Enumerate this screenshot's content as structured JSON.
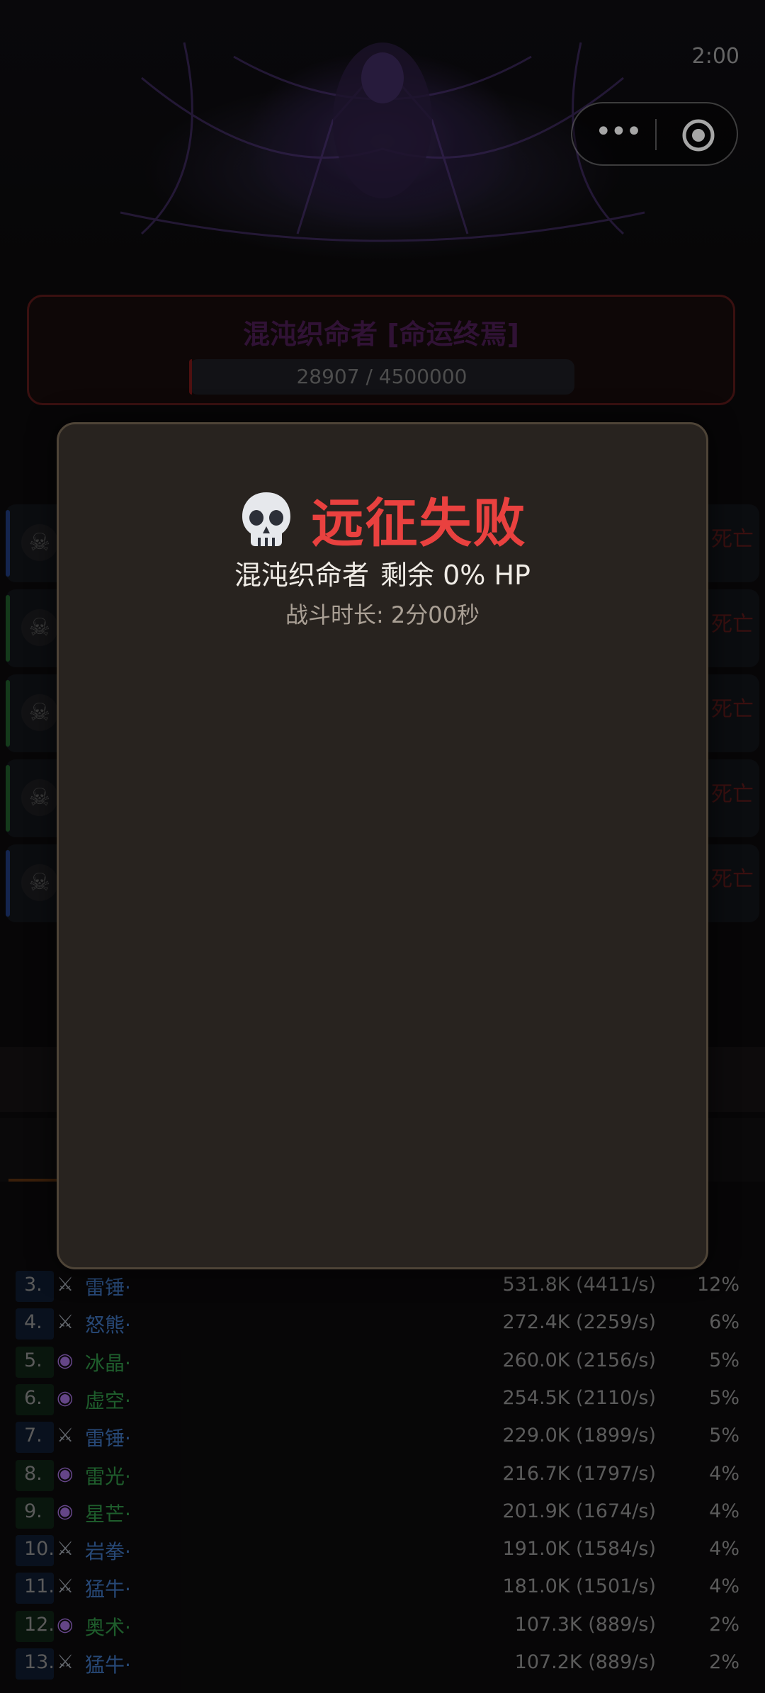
{
  "status_time": "2:00",
  "capsule": {
    "more_icon": "more-dots-icon",
    "close_icon": "target-circle-icon"
  },
  "boss": {
    "name": "混沌织命者 [命运终焉]",
    "hp_text": "28907 / 4500000",
    "hp_fraction": 0.0064
  },
  "party_dead_label": "死亡",
  "party_bar_colors": [
    "#1f3a7a",
    "#1f5a2a",
    "#1f5a2a",
    "#1f5a2a",
    "#1f3a7a"
  ],
  "ranking": [
    {
      "rank": "3.",
      "cls": "warrior",
      "name": "雷锤·",
      "dmg": "531.8K (4411/s)",
      "pct": "12%"
    },
    {
      "rank": "4.",
      "cls": "warrior",
      "name": "怒熊·",
      "dmg": "272.4K (2259/s)",
      "pct": "6%"
    },
    {
      "rank": "5.",
      "cls": "mage",
      "name": "冰晶·",
      "dmg": "260.0K (2156/s)",
      "pct": "5%"
    },
    {
      "rank": "6.",
      "cls": "mage",
      "name": "虚空·",
      "dmg": "254.5K (2110/s)",
      "pct": "5%"
    },
    {
      "rank": "7.",
      "cls": "warrior",
      "name": "雷锤·",
      "dmg": "229.0K (1899/s)",
      "pct": "5%"
    },
    {
      "rank": "8.",
      "cls": "mage",
      "name": "雷光·",
      "dmg": "216.7K (1797/s)",
      "pct": "4%"
    },
    {
      "rank": "9.",
      "cls": "mage",
      "name": "星芒·",
      "dmg": "201.9K (1674/s)",
      "pct": "4%"
    },
    {
      "rank": "10.",
      "cls": "warrior",
      "name": "岩拳·",
      "dmg": "191.0K (1584/s)",
      "pct": "4%"
    },
    {
      "rank": "11.",
      "cls": "warrior",
      "name": "猛牛·",
      "dmg": "181.0K (1501/s)",
      "pct": "4%"
    },
    {
      "rank": "12.",
      "cls": "mage",
      "name": "奥术·",
      "dmg": "107.3K (889/s)",
      "pct": "2%"
    },
    {
      "rank": "13.",
      "cls": "warrior",
      "name": "猛牛·",
      "dmg": "107.2K (889/s)",
      "pct": "2%"
    }
  ],
  "modal": {
    "icon": "skull-icon",
    "title": "远征失败",
    "boss_name": "混沌织命者",
    "remaining": "剩余 0% HP",
    "duration": "战斗时长: 2分00秒"
  },
  "colors": {
    "title_red": "#e9413f",
    "modal_bg": "#28231f",
    "warrior_blue": "#3c6fb6",
    "mage_green": "#2f8f44"
  }
}
